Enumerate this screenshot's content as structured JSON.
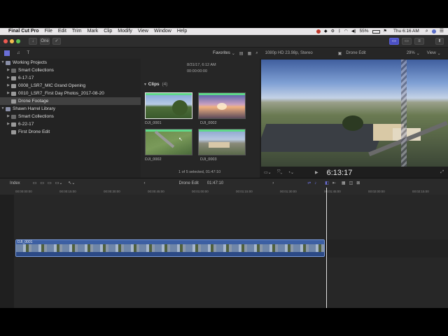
{
  "menubar": {
    "app_name": "Final Cut Pro",
    "items": [
      "File",
      "Edit",
      "Trim",
      "Mark",
      "Clip",
      "Modify",
      "View",
      "Window",
      "Help"
    ],
    "battery": "55%",
    "clock": "Thu 6:16 AM"
  },
  "toolbar": {
    "one_label": "One"
  },
  "browser_bar": {
    "favorites_label": "Favorites",
    "format_info": "1080p HD 23.98p, Stereo",
    "project_name": "Drone Edit",
    "zoom": "29%",
    "view_label": "View"
  },
  "libraries": [
    {
      "label": "Working Projects",
      "indent": 0,
      "disclosure": "▼",
      "type": "library"
    },
    {
      "label": "Smart Collections",
      "indent": 1,
      "disclosure": "▶",
      "type": "folder"
    },
    {
      "label": "6-17-17",
      "indent": 1,
      "disclosure": "▶",
      "type": "event"
    },
    {
      "label": "0008_LSR7_MIC Grand Opening",
      "indent": 1,
      "disclosure": "▶",
      "type": "event"
    },
    {
      "label": "0010_LSR7_First Day Photos_2017-08-20",
      "indent": 1,
      "disclosure": "▶",
      "type": "event"
    },
    {
      "label": "Drone Footage",
      "indent": 1,
      "disclosure": "",
      "type": "event",
      "selected": true
    },
    {
      "label": "Shawn Harrel Library",
      "indent": 0,
      "disclosure": "▼",
      "type": "library"
    },
    {
      "label": "Smart Collections",
      "indent": 1,
      "disclosure": "▶",
      "type": "folder"
    },
    {
      "label": "6-22-17",
      "indent": 1,
      "disclosure": "▶",
      "type": "event"
    },
    {
      "label": "First Drone Edit",
      "indent": 1,
      "disclosure": "",
      "type": "event"
    }
  ],
  "browser": {
    "date": "8/31/17, 6:12 AM",
    "timecode": "00:00:00:00",
    "clips_heading": "Clips",
    "clips_count": "(4)",
    "clips": [
      {
        "name": "DJI_0001",
        "selected": true
      },
      {
        "name": "DJI_0002",
        "selected": false
      },
      {
        "name": "DJI_0002",
        "selected": false
      },
      {
        "name": "DJI_0003",
        "selected": false
      }
    ],
    "status": "1 of 5 selected, 01:47:10"
  },
  "viewer": {
    "timecode": "6:13:17"
  },
  "timeline": {
    "index_label": "Index",
    "project_name": "Drone Edit",
    "duration": "01:47:10",
    "ruler": [
      "00:00:00:00",
      "00:00:15:00",
      "00:00:30:00",
      "00:00:45:00",
      "00:01:00:00",
      "00:01:15:00",
      "00:01:30:00",
      "00:01:45:00",
      "00:02:00:00",
      "00:02:15:00"
    ],
    "clip_name": "DJI_0001",
    "playhead_fraction": 0.764
  },
  "colors": {
    "accent": "#4a4fc4",
    "clip_blue": "#3c5fa3",
    "selection": "#414141"
  }
}
